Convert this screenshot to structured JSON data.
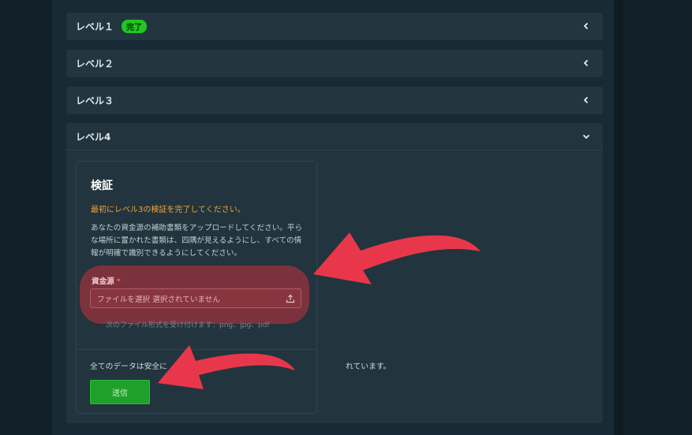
{
  "levels": [
    {
      "label": "レベル１",
      "badge": "完了"
    },
    {
      "label": "レベル２"
    },
    {
      "label": "レベル３"
    }
  ],
  "level4": {
    "label": "レベル4",
    "card": {
      "title": "検証",
      "warning": "最初にレベル3の検証を完了してください。",
      "description": "あなたの資金源の補助書類をアップロードしてください。平らな場所に置かれた書類は、四隅が見えるようにし、すべての情報が明確で識別できるようにしてください。",
      "field_label": "資金源",
      "required_mark": "*",
      "file_input_text": "ファイルを選択 選択されていません",
      "formats_note": "次のファイル形式を受け付けます：png、jpg、pdf",
      "secure_prefix": "全てのデータは安全に",
      "secure_suffix": "れています。",
      "submit_label": "送信"
    }
  },
  "colors": {
    "badge": "#1ec81e",
    "warning": "#f0a23a",
    "submit": "#1ea02a",
    "arrow": "#e8374a"
  },
  "icons": {
    "collapsed": "chevron-left-icon",
    "expanded": "chevron-down-icon",
    "upload": "upload-icon"
  }
}
